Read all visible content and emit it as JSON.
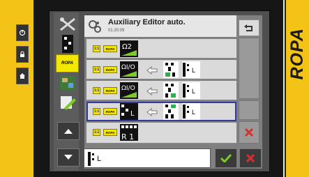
{
  "brand": "ROPA",
  "header": {
    "title": "Auxiliary Editor auto.",
    "code": "01.20.09"
  },
  "sidebar": {
    "ropa_label": "ROPA"
  },
  "rows": [
    {
      "tag": "1:1",
      "brand": "ROPA",
      "func": "Ω2",
      "arrow": false,
      "devices": []
    },
    {
      "tag": "1:1",
      "brand": "ROPA",
      "func": "Ω I/O",
      "arrow": true,
      "devices": [
        "",
        "L"
      ]
    },
    {
      "tag": "1:1",
      "brand": "ROPA",
      "func": "Ω I/O",
      "arrow": true,
      "devices": [
        "",
        "L"
      ]
    },
    {
      "tag": "1:1",
      "brand": "ROPA",
      "func": "L",
      "arrow": true,
      "devices": [
        "",
        "L"
      ]
    },
    {
      "tag": "1:1",
      "brand": "ROPA",
      "func": "R 1",
      "arrow": false,
      "devices": []
    }
  ],
  "bottom": {
    "value": "L"
  },
  "colors": {
    "accent_yellow": "#f3c316",
    "selection": "#333b9e",
    "ok_green": "#7acb27",
    "cancel_red": "#d9302e"
  }
}
